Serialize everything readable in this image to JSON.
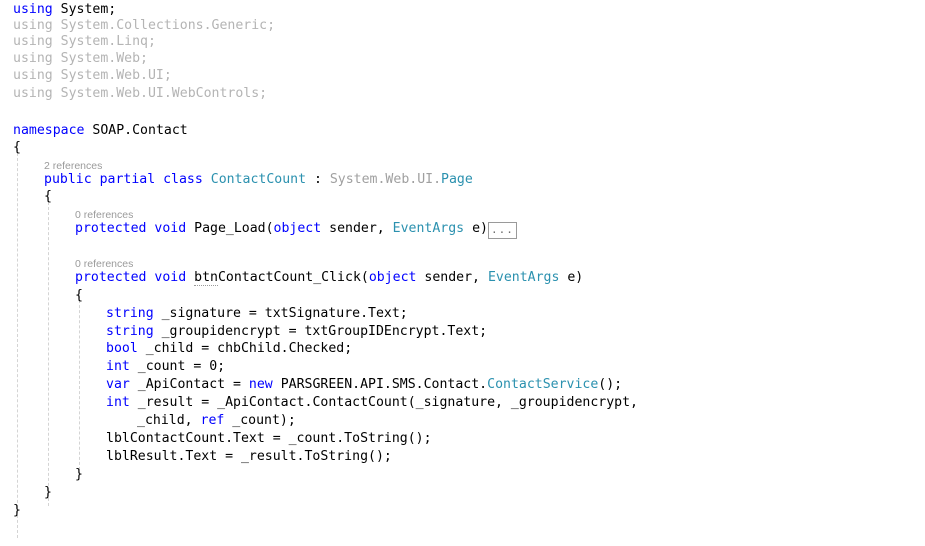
{
  "editor": {
    "language": "csharp",
    "background": "#ffffff",
    "colors": {
      "keyword": "#0000ff",
      "type": "#2b91af",
      "plain": "#000000",
      "unused_using": "#b4b4b4",
      "codelens": "#9a9a9a",
      "indent_guide": "#d4d4d4"
    }
  },
  "code": {
    "lines": [
      {
        "id": "line-using-system",
        "indent": 0,
        "text": "using System;"
      },
      {
        "id": "line-using-collections",
        "indent": 0,
        "text": "using System.Collections.Generic;"
      },
      {
        "id": "line-using-linq",
        "indent": 0,
        "text": "using System.Linq;"
      },
      {
        "id": "line-using-web",
        "indent": 0,
        "text": "using System.Web;"
      },
      {
        "id": "line-using-webui",
        "indent": 0,
        "text": "using System.Web.UI;"
      },
      {
        "id": "line-using-webcontrols",
        "indent": 0,
        "text": "using System.Web.UI.WebControls;"
      },
      {
        "id": "line-namespace",
        "indent": 0,
        "text": "namespace SOAP.Contact"
      },
      {
        "id": "line-namespace-open",
        "indent": 0,
        "text": "{"
      },
      {
        "id": "line-class-decl",
        "indent": 1,
        "text": "public partial class ContactCount : System.Web.UI.Page"
      },
      {
        "id": "line-class-open",
        "indent": 1,
        "text": "{"
      },
      {
        "id": "line-pageload",
        "indent": 2,
        "text": "protected void Page_Load(object sender, EventArgs e)"
      },
      {
        "id": "line-btnclick",
        "indent": 2,
        "text": "protected void btnContactCount_Click(object sender, EventArgs e)"
      },
      {
        "id": "line-method-open",
        "indent": 2,
        "text": "{"
      },
      {
        "id": "line-signature",
        "indent": 3,
        "text": "string _signature = txtSignature.Text;"
      },
      {
        "id": "line-groupidencrypt",
        "indent": 3,
        "text": "string _groupidencrypt = txtGroupIDEncrypt.Text;"
      },
      {
        "id": "line-child",
        "indent": 3,
        "text": "bool _child = chbChild.Checked;"
      },
      {
        "id": "line-count",
        "indent": 3,
        "text": "int _count = 0;"
      },
      {
        "id": "line-apicontact",
        "indent": 3,
        "text": "var _ApiContact = new PARSGREEN.API.SMS.Contact.ContactService();"
      },
      {
        "id": "line-result",
        "indent": 3,
        "text": "int _result = _ApiContact.ContactCount(_signature, _groupidencrypt,"
      },
      {
        "id": "line-result-cont",
        "indent": 4,
        "text": "_child, ref _count);"
      },
      {
        "id": "line-lblcontactcount",
        "indent": 3,
        "text": "lblContactCount.Text = _count.ToString();"
      },
      {
        "id": "line-lblresult",
        "indent": 3,
        "text": "lblResult.Text = _result.ToString();"
      },
      {
        "id": "line-method-close",
        "indent": 2,
        "text": "}"
      },
      {
        "id": "line-class-close",
        "indent": 1,
        "text": "}"
      },
      {
        "id": "line-namespace-close",
        "indent": 0,
        "text": "}"
      }
    ],
    "tokens": {
      "using_kw": "using",
      "namespace_kw": "namespace",
      "namespace_name": "SOAP.Contact",
      "using_system": "System;",
      "using_collections": "System.Collections.Generic;",
      "using_linq": "System.Linq;",
      "using_web": "System.Web;",
      "using_webui": "System.Web.UI;",
      "using_webcontrols": "System.Web.UI.WebControls;",
      "public_partial_class": "public partial class",
      "class_name": "ContactCount",
      "colon": " : ",
      "base_namespace": "System.Web.UI.",
      "base_type": "Page",
      "protected": "protected",
      "void": "void",
      "pageload_name": "Page_Load(",
      "object": "object",
      "sender": " sender, ",
      "eventargs": "EventArgs",
      "e_close": " e)",
      "btnclick_prefix": "btn",
      "btnclick_rest": "ContactCount_Click(",
      "brace_open": "{",
      "brace_close": "}",
      "string_kw": "string",
      "bool_kw": "bool",
      "int_kw": "int",
      "var_kw": "var",
      "new_kw": "new",
      "ref_kw": "ref",
      "signature_rest": " _signature = txtSignature.Text;",
      "groupid_rest": " _groupidencrypt = txtGroupIDEncrypt.Text;",
      "child_rest": " _child = chbChild.Checked;",
      "count_rest": " _count = 0;",
      "apicontact_mid": " _ApiContact = ",
      "apicontact_ns": " PARSGREEN.API.SMS.Contact.",
      "apicontact_type": "ContactService",
      "apicontact_tail": "();",
      "result_rest": " _result = _ApiContact.ContactCount(_signature, _groupidencrypt,",
      "result_cont_a": "_child, ",
      "result_cont_b": " _count);",
      "lblcontactcount": "lblContactCount.Text = _count.ToString();",
      "lblresult": "lblResult.Text = _result.ToString();"
    }
  },
  "codelens": [
    {
      "id": "codelens-class",
      "text": "2 references"
    },
    {
      "id": "codelens-pageload",
      "text": "0 references"
    },
    {
      "id": "codelens-btnclick",
      "text": "0 references"
    }
  ],
  "collapsed_region": {
    "label": "..."
  }
}
